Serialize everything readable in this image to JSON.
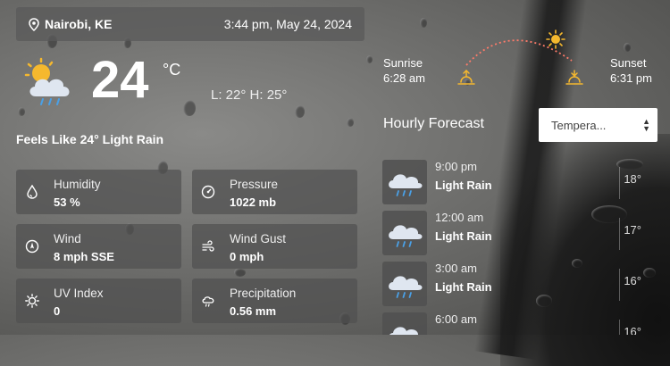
{
  "header": {
    "location": "Nairobi, KE",
    "datetime": "3:44 pm, May 24, 2024"
  },
  "current": {
    "temperature": "24",
    "unit": "°C",
    "low_high": "L: 22°  H: 25°",
    "feels_like": "Feels Like 24° Light Rain",
    "icon": "cloud-sun-rain-icon"
  },
  "details": [
    {
      "label": "Humidity",
      "value": "53 %",
      "icon": "droplet-icon"
    },
    {
      "label": "Pressure",
      "value": "1022 mb",
      "icon": "gauge-icon"
    },
    {
      "label": "Wind",
      "value": "8 mph SSE",
      "icon": "compass-icon"
    },
    {
      "label": "Wind Gust",
      "value": "0 mph",
      "icon": "wind-icon"
    },
    {
      "label": "UV Index",
      "value": "0",
      "icon": "sun-uv-icon"
    },
    {
      "label": "Precipitation",
      "value": "0.56 mm",
      "icon": "cloud-rain-icon"
    }
  ],
  "sun": {
    "sunrise_label": "Sunrise",
    "sunrise_time": "6:28 am",
    "sunset_label": "Sunset",
    "sunset_time": "6:31 pm"
  },
  "hourly": {
    "title": "Hourly Forecast",
    "select_value": "Tempera...",
    "items": [
      {
        "time": "9:00 pm",
        "condition": "Light Rain",
        "temp": "18°"
      },
      {
        "time": "12:00 am",
        "condition": "Light Rain",
        "temp": "17°"
      },
      {
        "time": "3:00 am",
        "condition": "Light Rain",
        "temp": "16°"
      },
      {
        "time": "6:00 am",
        "condition": "",
        "temp": "16°"
      }
    ]
  }
}
